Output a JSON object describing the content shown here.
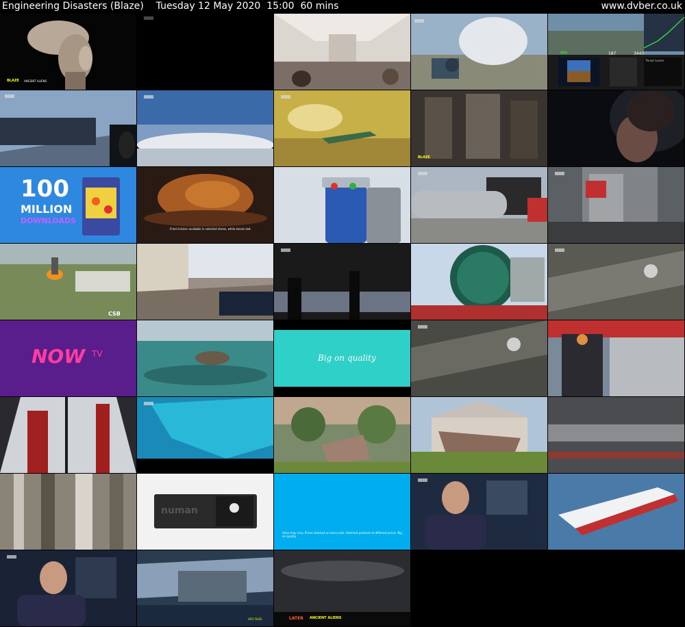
{
  "header": {
    "title": "Engineering Disasters (Blaze)    Tuesday 12 May 2020  15:00  60 mins",
    "url": "www.dvber.co.uk"
  },
  "channel_logo": "BLAZE",
  "thumbnails": {
    "t1": {
      "caption": "ANCIENT ALIENS"
    },
    "t5": {
      "speed_label": "SPD",
      "speed_value": "187",
      "alt_value": "3440",
      "thrust_label": "Thrust Levers"
    },
    "t14": {
      "caption": "ANCIENT ALIENS"
    },
    "t16": {
      "line1": "100",
      "line2": "MILLION",
      "line3": "DOWNLOADS"
    },
    "t17": {
      "subtitle": "Fried chicken available in selected stores, while stocks last."
    },
    "t31": {
      "caption": "CSB"
    },
    "t36": {
      "brand": "NOW",
      "brand_tv": "TV"
    },
    "t38": {
      "slogan": "Big on quality"
    },
    "t52": {
      "brand": "numan"
    },
    "t53": {
      "legal": "Voice may vary. Prices checked on tesco.com. Selected products at different prices. Big on quality."
    },
    "t58": {
      "caption": "UFO FILES"
    },
    "t59": {
      "later": "LATER",
      "caption": "ANCIENT ALIENS"
    }
  },
  "colors": {
    "header_bg": "#000000",
    "header_text": "#ffffff",
    "now_purple": "#5a1e8c",
    "now_pink": "#ff3ca0",
    "tesco_teal": "#2fd0c8",
    "tesco_blue": "#00aeef"
  }
}
